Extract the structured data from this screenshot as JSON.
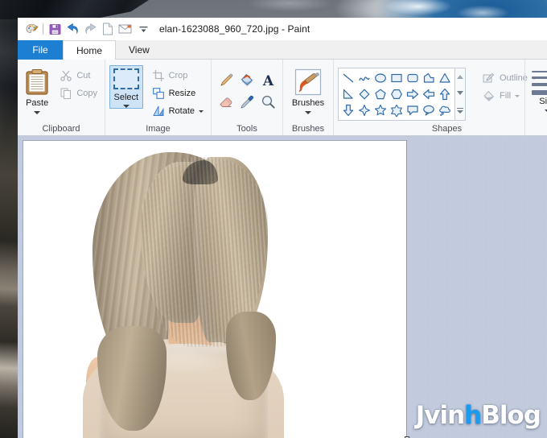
{
  "desktop": {
    "wallpaper_description": "dark mountain rock and cloudy sky"
  },
  "window": {
    "title": "elan-1623088_960_720.jpg - Paint",
    "app_name": "Paint",
    "file_name": "elan-1623088_960_720.jpg"
  },
  "quick_access": {
    "items": [
      {
        "name": "paint-palette-icon",
        "tooltip": "Paint"
      },
      {
        "name": "save-icon",
        "tooltip": "Save"
      },
      {
        "name": "undo-icon",
        "tooltip": "Undo"
      },
      {
        "name": "redo-icon",
        "tooltip": "Redo"
      },
      {
        "name": "new-file-icon",
        "tooltip": "New"
      },
      {
        "name": "email-icon",
        "tooltip": "Send in e-mail"
      },
      {
        "name": "customize-dropdown-icon",
        "tooltip": "Customize Quick Access Toolbar"
      }
    ]
  },
  "tabs": [
    {
      "label": "File",
      "active": false,
      "style": "file"
    },
    {
      "label": "Home",
      "active": true,
      "style": "normal"
    },
    {
      "label": "View",
      "active": false,
      "style": "normal"
    }
  ],
  "ribbon": {
    "groups": [
      {
        "label": "Clipboard",
        "paste": {
          "label": "Paste",
          "has_dropdown": true,
          "enabled": true
        },
        "cut": {
          "label": "Cut",
          "enabled": false
        },
        "copy": {
          "label": "Copy",
          "enabled": false
        }
      },
      {
        "label": "Image",
        "select": {
          "label": "Select",
          "has_dropdown": true,
          "highlighted": true
        },
        "crop": {
          "label": "Crop",
          "enabled": false
        },
        "resize": {
          "label": "Resize",
          "enabled": true
        },
        "rotate": {
          "label": "Rotate",
          "enabled": true,
          "has_dropdown": true
        }
      },
      {
        "label": "Tools",
        "tools": [
          {
            "name": "pencil-icon",
            "tooltip": "Pencil"
          },
          {
            "name": "fill-with-color-icon",
            "tooltip": "Fill with color"
          },
          {
            "name": "text-icon",
            "tooltip": "Text"
          },
          {
            "name": "eraser-icon",
            "tooltip": "Eraser"
          },
          {
            "name": "color-picker-icon",
            "tooltip": "Color picker"
          },
          {
            "name": "magnifier-icon",
            "tooltip": "Magnifier"
          }
        ]
      },
      {
        "label": "Brushes",
        "brushes": {
          "label": "Brushes",
          "has_dropdown": true
        }
      },
      {
        "label": "Shapes",
        "shapes": [
          "line",
          "curve",
          "oval",
          "rectangle",
          "rounded-rectangle",
          "polygon",
          "triangle",
          "right-triangle",
          "diamond",
          "pentagon",
          "hexagon",
          "right-arrow",
          "left-arrow",
          "up-arrow",
          "down-arrow",
          "four-point-star",
          "five-point-star",
          "six-point-star",
          "rounded-rectangular-callout",
          "oval-callout",
          "cloud-callout"
        ],
        "outline": {
          "label": "Outline",
          "has_dropdown": true,
          "enabled": false
        },
        "fill": {
          "label": "Fill",
          "has_dropdown": true,
          "enabled": false
        }
      },
      {
        "label": "Size",
        "size": {
          "label": "Size",
          "has_dropdown": true
        },
        "line_widths": [
          2,
          3,
          4,
          6
        ]
      }
    ]
  },
  "canvas": {
    "background": "#ffffff",
    "content_description": "portrait photo of a blonde woman on white background"
  },
  "watermark": {
    "part1": "Jvin",
    "part2": "h",
    "part3": "Blog",
    "accent_color": "#1a9bf0"
  },
  "colors": {
    "file_tab": "#1d7fd1",
    "ribbon_bg": "#f7f8f9",
    "workspace_bg": "#c2cbdd",
    "select_highlight": "#cfe3f7"
  }
}
